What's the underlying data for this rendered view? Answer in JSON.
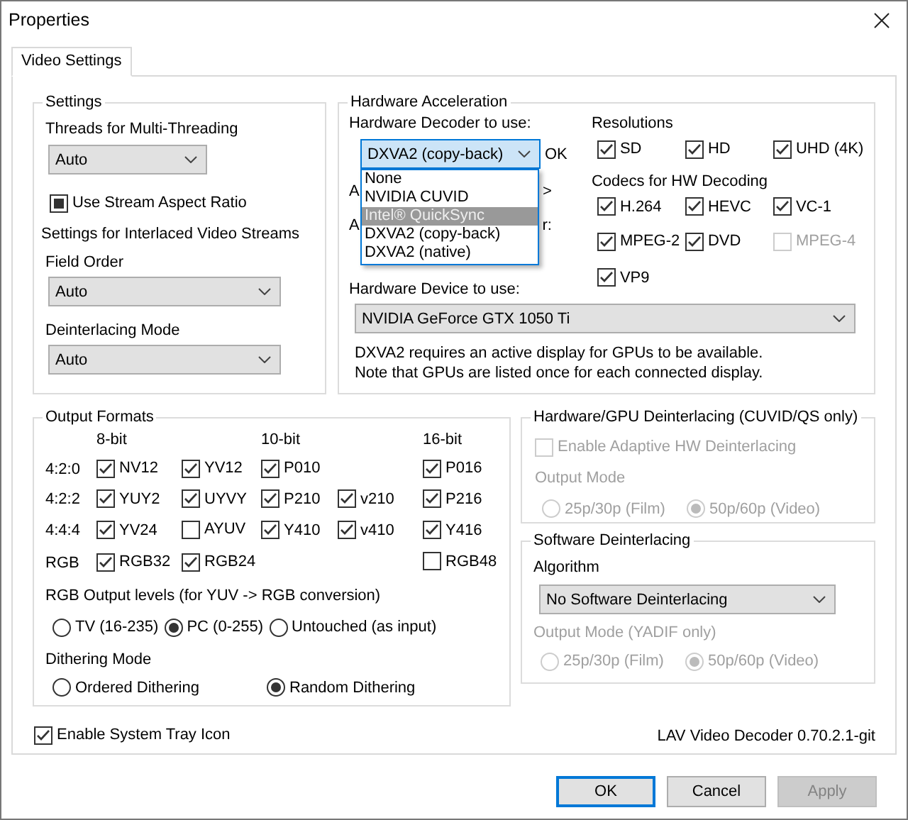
{
  "window": {
    "title": "Properties"
  },
  "tabs": [
    {
      "label": "Video Settings",
      "selected": true
    }
  ],
  "settings": {
    "title": "Settings",
    "threads": {
      "label": "Threads for Multi-Threading",
      "value": "Auto"
    },
    "stream_aspect": {
      "label": "Use Stream Aspect Ratio",
      "indeterminate": true
    },
    "interlaced_title": "Settings for Interlaced Video Streams",
    "field_order": {
      "label": "Field Order",
      "value": "Auto"
    },
    "deinterlacing_mode": {
      "label": "Deinterlacing Mode",
      "value": "Auto"
    }
  },
  "hardware_acceleration": {
    "title": "Hardware Acceleration",
    "decoder": {
      "label": "Hardware Decoder to use:",
      "value": "DXVA2 (copy-back)",
      "expanded": true,
      "status": "OK",
      "options": [
        {
          "label": "None",
          "highlighted": false
        },
        {
          "label": "NVIDIA CUVID",
          "highlighted": false
        },
        {
          "label": "Intel® QuickSync",
          "highlighted": true
        },
        {
          "label": "DXVA2 (copy-back)",
          "highlighted": false
        },
        {
          "label": "DXVA2 (native)",
          "highlighted": false
        }
      ]
    },
    "covered_labels": [
      {
        "start": "A",
        "end": ">"
      },
      {
        "start": "A",
        "end": "r:"
      }
    ],
    "resolutions": {
      "title": "Resolutions",
      "items": [
        {
          "label": "SD",
          "checked": true,
          "disabled": false
        },
        {
          "label": "HD",
          "checked": true,
          "disabled": false
        },
        {
          "label": "UHD (4K)",
          "checked": true,
          "disabled": false
        }
      ]
    },
    "codecs": {
      "title": "Codecs for HW Decoding",
      "items": [
        {
          "label": "H.264",
          "checked": true,
          "disabled": false
        },
        {
          "label": "HEVC",
          "checked": true,
          "disabled": false
        },
        {
          "label": "VC-1",
          "checked": true,
          "disabled": false
        },
        {
          "label": "MPEG-2",
          "checked": true,
          "disabled": false
        },
        {
          "label": "DVD",
          "checked": true,
          "disabled": false
        },
        {
          "label": "MPEG-4",
          "checked": false,
          "disabled": true
        },
        {
          "label": "VP9",
          "checked": true,
          "disabled": false
        }
      ]
    },
    "device": {
      "label": "Hardware Device to use:",
      "value": "NVIDIA GeForce GTX 1050 Ti"
    },
    "notes": [
      "DXVA2 requires an active display for GPUs to be available.",
      "Note that GPUs are listed once for each connected display."
    ]
  },
  "output_formats": {
    "title": "Output Formats",
    "headers": [
      {
        "kind": "label",
        "label": "8-bit"
      },
      {
        "kind": "empty"
      },
      {
        "kind": "label",
        "label": "10-bit"
      },
      {
        "kind": "empty"
      },
      {
        "kind": "label",
        "label": "16-bit"
      }
    ],
    "rows": [
      {
        "label": "4:2:0",
        "cells": [
          {
            "kind": "checkbox",
            "label": "NV12",
            "checked": true
          },
          {
            "kind": "checkbox",
            "label": "YV12",
            "checked": true
          },
          {
            "kind": "checkbox",
            "label": "P010",
            "checked": true
          },
          {
            "kind": "empty"
          },
          {
            "kind": "checkbox",
            "label": "P016",
            "checked": true
          }
        ]
      },
      {
        "label": "4:2:2",
        "cells": [
          {
            "kind": "checkbox",
            "label": "YUY2",
            "checked": true
          },
          {
            "kind": "checkbox",
            "label": "UYVY",
            "checked": true
          },
          {
            "kind": "checkbox",
            "label": "P210",
            "checked": true
          },
          {
            "kind": "checkbox",
            "label": "v210",
            "checked": true
          },
          {
            "kind": "checkbox",
            "label": "P216",
            "checked": true
          }
        ]
      },
      {
        "label": "4:4:4",
        "cells": [
          {
            "kind": "checkbox",
            "label": "YV24",
            "checked": true
          },
          {
            "kind": "checkbox",
            "label": "AYUV",
            "checked": false
          },
          {
            "kind": "checkbox",
            "label": "Y410",
            "checked": true
          },
          {
            "kind": "checkbox",
            "label": "v410",
            "checked": true
          },
          {
            "kind": "checkbox",
            "label": "Y416",
            "checked": true
          }
        ]
      },
      {
        "label": "RGB",
        "cells": [
          {
            "kind": "checkbox",
            "label": "RGB32",
            "checked": true
          },
          {
            "kind": "checkbox",
            "label": "RGB24",
            "checked": true
          },
          {
            "kind": "empty"
          },
          {
            "kind": "empty"
          },
          {
            "kind": "checkbox",
            "label": "RGB48",
            "checked": false
          }
        ]
      }
    ],
    "rgb_levels": {
      "label": "RGB Output levels (for YUV -> RGB conversion)",
      "options": [
        {
          "label": "TV (16-235)",
          "selected": false
        },
        {
          "label": "PC (0-255)",
          "selected": true
        },
        {
          "label": "Untouched (as input)",
          "selected": false
        }
      ]
    },
    "dithering": {
      "label": "Dithering Mode",
      "options": [
        {
          "label": "Ordered Dithering",
          "selected": false
        },
        {
          "label": "Random Dithering",
          "selected": true
        }
      ]
    }
  },
  "hw_deinterlacing": {
    "title": "Hardware/GPU Deinterlacing (CUVID/QS only)",
    "enable": {
      "label": "Enable Adaptive HW Deinterlacing",
      "checked": false,
      "disabled": true
    },
    "output_mode": {
      "label": "Output Mode",
      "disabled": true,
      "options": [
        {
          "label": "25p/30p (Film)",
          "selected": false
        },
        {
          "label": "50p/60p (Video)",
          "selected": true
        }
      ]
    }
  },
  "sw_deinterlacing": {
    "title": "Software Deinterlacing",
    "algorithm": {
      "label": "Algorithm",
      "value": "No Software Deinterlacing"
    },
    "output_mode": {
      "label": "Output Mode (YADIF only)",
      "disabled": true,
      "options": [
        {
          "label": "25p/30p (Film)",
          "selected": false
        },
        {
          "label": "50p/60p (Video)",
          "selected": true
        }
      ]
    }
  },
  "system_tray": {
    "label": "Enable System Tray Icon",
    "checked": true
  },
  "version": "LAV Video Decoder 0.70.2.1-git",
  "buttons": [
    {
      "label": "OK",
      "default": true,
      "disabled": false
    },
    {
      "label": "Cancel",
      "default": false,
      "disabled": false
    },
    {
      "label": "Apply",
      "default": false,
      "disabled": true
    }
  ]
}
